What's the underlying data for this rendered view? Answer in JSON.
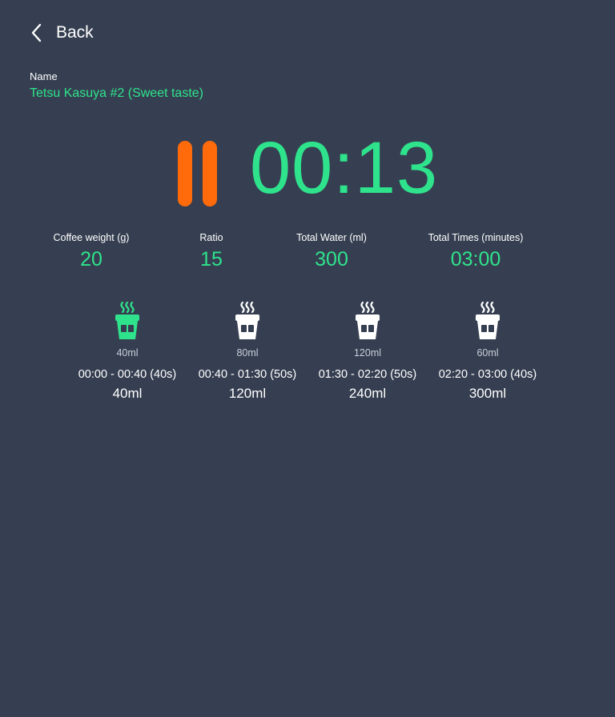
{
  "header": {
    "back_label": "Back"
  },
  "recipe": {
    "name_label": "Name",
    "name_value": "Tetsu Kasuya #2 (Sweet taste)"
  },
  "timer": {
    "value": "00:13",
    "control_icon": "pause-icon",
    "control_color": "#ff6b0a"
  },
  "stats": [
    {
      "label": "Coffee weight (g)",
      "value": "20"
    },
    {
      "label": "Ratio",
      "value": "15"
    },
    {
      "label": "Total Water (ml)",
      "value": "300"
    },
    {
      "label": "Total Times (minutes)",
      "value": "03:00"
    }
  ],
  "steps": [
    {
      "amount": "40ml",
      "range": "00:00 - 00:40 (40s)",
      "total": "40ml",
      "active": true
    },
    {
      "amount": "80ml",
      "range": "00:40 - 01:30 (50s)",
      "total": "120ml",
      "active": false
    },
    {
      "amount": "120ml",
      "range": "01:30 - 02:20 (50s)",
      "total": "240ml",
      "active": false
    },
    {
      "amount": "60ml",
      "range": "02:20 - 03:00 (40s)",
      "total": "300ml",
      "active": false
    }
  ],
  "colors": {
    "background": "#363f51",
    "accent": "#2ee38c",
    "pause": "#ff6b0a",
    "text": "#ffffff",
    "inactive_icon": "#ffffff"
  }
}
